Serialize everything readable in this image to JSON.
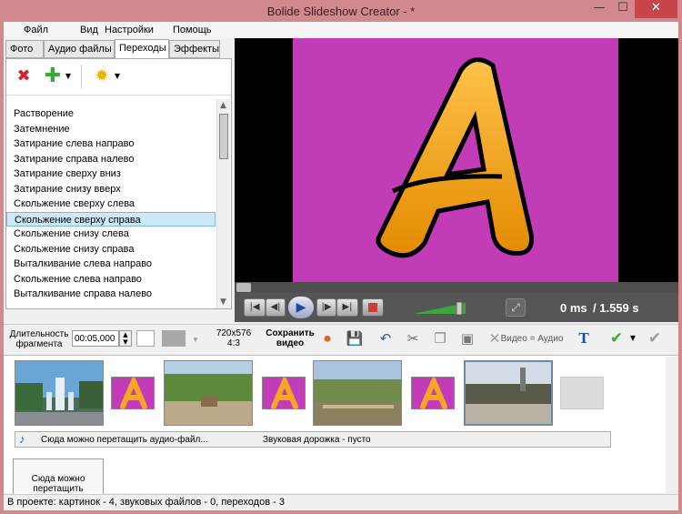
{
  "window": {
    "title": "Bolide Slideshow Creator - *",
    "min": "—",
    "max": "☐",
    "close": "✕"
  },
  "menu": [
    "Файл",
    "Вид",
    "Настройки",
    "Помощь"
  ],
  "tabs": [
    "Фото",
    "Аудио файлы",
    "Переходы",
    "Эффекты"
  ],
  "active_tab": 2,
  "transitions": [
    "Растворение",
    "Затемнение",
    "Затирание слева направо",
    "Затирание справа налево",
    "Затирание сверху вниз",
    "Затирание снизу вверх",
    "Скольжение сверху слева",
    "Скольжение сверху справа",
    "Скольжение снизу слева",
    "Скольжение снизу справа",
    "Выталкивание слева направо",
    "Скольжение слева направо",
    "Выталкивание справа налево"
  ],
  "selected_transition": 7,
  "player": {
    "current": "0 ms",
    "total": "/ 1.559 s",
    "preview_letter": "A",
    "preview_bg": "#c23cb8",
    "letter_color": "#f5a623"
  },
  "toolbar": {
    "duration_label": "Длительность фрагмента",
    "duration_value": "00:05,000",
    "resolution": "720x576",
    "aspect": "4:3",
    "save_video": "Сохранить видео",
    "video_audio": "Видео = Аудио"
  },
  "timeline": {
    "audio_drop": "Сюда можно перетащить аудио-файл...",
    "audio_track": "Звуковая дорожка - пусто",
    "drop_images": "Сюда можно перетащить"
  },
  "status": "В проекте: картинок - 4, звуковых файлов - 0, переходов - 3"
}
